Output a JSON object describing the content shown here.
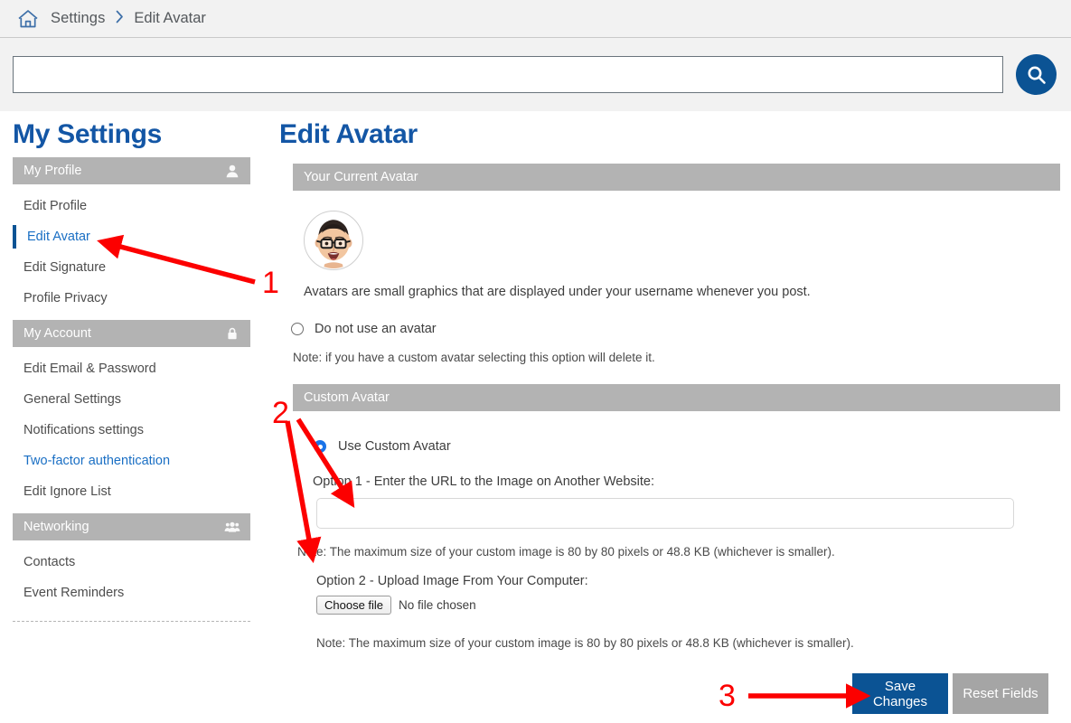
{
  "breadcrumb": {
    "home_icon": "home-icon",
    "items": [
      "Settings",
      "Edit Avatar"
    ],
    "separator": "›"
  },
  "search": {
    "value": "",
    "placeholder": "",
    "button_icon": "search-icon"
  },
  "sidebar": {
    "title": "My Settings",
    "groups": [
      {
        "header": "My Profile",
        "icon": "user-icon",
        "items": [
          {
            "label": "Edit Profile",
            "state": "normal"
          },
          {
            "label": "Edit Avatar",
            "state": "active"
          },
          {
            "label": "Edit Signature",
            "state": "normal"
          },
          {
            "label": "Profile Privacy",
            "state": "normal"
          }
        ]
      },
      {
        "header": "My Account",
        "icon": "lock-icon",
        "items": [
          {
            "label": "Edit Email & Password",
            "state": "normal"
          },
          {
            "label": "General Settings",
            "state": "normal"
          },
          {
            "label": "Notifications settings",
            "state": "normal"
          },
          {
            "label": "Two-factor authentication",
            "state": "link"
          },
          {
            "label": "Edit Ignore List",
            "state": "normal"
          }
        ]
      },
      {
        "header": "Networking",
        "icon": "group-icon",
        "items": [
          {
            "label": "Contacts",
            "state": "normal"
          },
          {
            "label": "Event Reminders",
            "state": "normal"
          }
        ]
      }
    ]
  },
  "main": {
    "title": "Edit Avatar",
    "current_avatar": {
      "panel_title": "Your Current Avatar",
      "avatar_alt": "avatar-image",
      "description": "Avatars are small graphics that are displayed under your username whenever you post.",
      "no_avatar_option": {
        "label": "Do not use an avatar",
        "checked": false
      },
      "no_avatar_note": "Note: if you have a custom avatar selecting this option will delete it."
    },
    "custom_avatar": {
      "panel_title": "Custom Avatar",
      "use_custom_option": {
        "label": "Use Custom Avatar",
        "checked": true
      },
      "option1_label": "Option 1 - Enter the URL to the Image on Another Website:",
      "option1_value": "",
      "option1_placeholder": "",
      "option1_note": "Note: The maximum size of your custom image is 80 by 80 pixels or 48.8 KB (whichever is smaller).",
      "option2_label": "Option 2 - Upload Image From Your Computer:",
      "file_button_label": "Choose file",
      "file_status": "No file chosen",
      "option2_note": "Note: The maximum size of your custom image is 80 by 80 pixels or 48.8 KB (whichever is smaller)."
    },
    "actions": {
      "save_label": "Save Changes",
      "reset_label": "Reset Fields"
    }
  },
  "annotations": {
    "color": "#fc0000",
    "markers": [
      {
        "number": "1",
        "target": "sidebar-item-edit-avatar"
      },
      {
        "number": "2",
        "target": "custom-avatar-url-and-upload"
      },
      {
        "number": "3",
        "target": "save-changes-button"
      }
    ]
  },
  "colors": {
    "brand_blue": "#0b5394",
    "heading_blue": "#1356a5",
    "link_blue": "#1a6fc4",
    "panel_gray": "#b3b3b3",
    "page_bg": "#f2f2f2",
    "annotation_red": "#fc0000"
  }
}
